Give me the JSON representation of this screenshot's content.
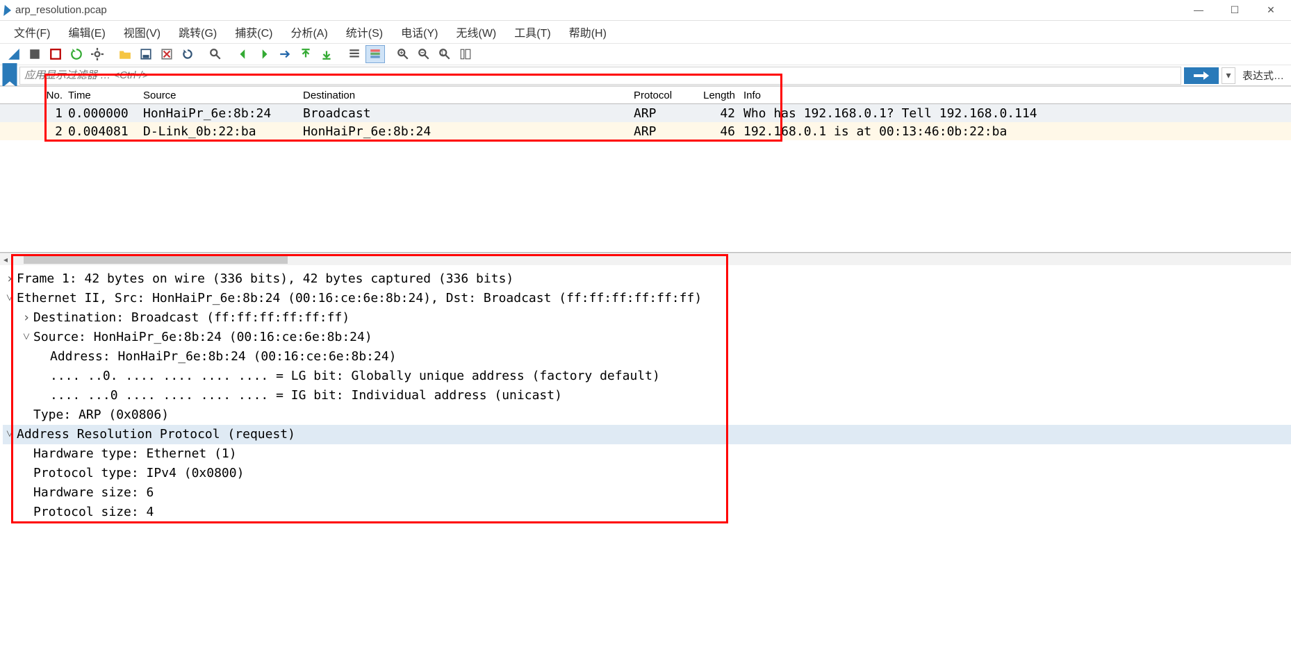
{
  "window": {
    "title": "arp_resolution.pcap"
  },
  "menu": [
    "文件(F)",
    "编辑(E)",
    "视图(V)",
    "跳转(G)",
    "捕获(C)",
    "分析(A)",
    "统计(S)",
    "电话(Y)",
    "无线(W)",
    "工具(T)",
    "帮助(H)"
  ],
  "toolbar_icons": [
    "fin",
    "start",
    "stop",
    "restart",
    "gear",
    "sep",
    "open",
    "save",
    "close",
    "reload",
    "sep",
    "find",
    "sep",
    "back",
    "fwd",
    "goto",
    "gotop",
    "gobot",
    "sep",
    "autoscroll",
    "coloring",
    "sep",
    "zoomin",
    "zoomout",
    "zoomreset",
    "resize"
  ],
  "filter": {
    "placeholder": "应用显示过滤器 … <Ctrl-/>",
    "expression_label": "表达式…"
  },
  "columns": {
    "no": "No.",
    "time": "Time",
    "source": "Source",
    "destination": "Destination",
    "protocol": "Protocol",
    "length": "Length",
    "info": "Info"
  },
  "packets": [
    {
      "no": "1",
      "time": "0.000000",
      "source": "HonHaiPr_6e:8b:24",
      "destination": "Broadcast",
      "protocol": "ARP",
      "length": "42",
      "info": "Who has 192.168.0.1? Tell 192.168.0.114",
      "sel": true
    },
    {
      "no": "2",
      "time": "0.004081",
      "source": "D-Link_0b:22:ba",
      "destination": "HonHaiPr_6e:8b:24",
      "protocol": "ARP",
      "length": "46",
      "info": "192.168.0.1 is at 00:13:46:0b:22:ba",
      "sel": false
    }
  ],
  "details": [
    {
      "tw": "›",
      "indent": 0,
      "text": "Frame 1: 42 bytes on wire (336 bits), 42 bytes captured (336 bits)",
      "hl": false
    },
    {
      "tw": "˅",
      "indent": 0,
      "text": "Ethernet II, Src: HonHaiPr_6e:8b:24 (00:16:ce:6e:8b:24), Dst: Broadcast (ff:ff:ff:ff:ff:ff)",
      "hl": false
    },
    {
      "tw": "›",
      "indent": 1,
      "text": "Destination: Broadcast (ff:ff:ff:ff:ff:ff)",
      "hl": false
    },
    {
      "tw": "˅",
      "indent": 1,
      "text": "Source: HonHaiPr_6e:8b:24 (00:16:ce:6e:8b:24)",
      "hl": false
    },
    {
      "tw": "",
      "indent": 2,
      "text": "Address: HonHaiPr_6e:8b:24 (00:16:ce:6e:8b:24)",
      "hl": false
    },
    {
      "tw": "",
      "indent": 2,
      "text": ".... ..0. .... .... .... .... = LG bit: Globally unique address (factory default)",
      "hl": false
    },
    {
      "tw": "",
      "indent": 2,
      "text": ".... ...0 .... .... .... .... = IG bit: Individual address (unicast)",
      "hl": false
    },
    {
      "tw": "",
      "indent": 1,
      "text": "Type: ARP (0x0806)",
      "hl": false
    },
    {
      "tw": "˅",
      "indent": 0,
      "text": "Address Resolution Protocol (request)",
      "hl": true
    },
    {
      "tw": "",
      "indent": 1,
      "text": "Hardware type: Ethernet (1)",
      "hl": false
    },
    {
      "tw": "",
      "indent": 1,
      "text": "Protocol type: IPv4 (0x0800)",
      "hl": false
    },
    {
      "tw": "",
      "indent": 1,
      "text": "Hardware size: 6",
      "hl": false
    },
    {
      "tw": "",
      "indent": 1,
      "text": "Protocol size: 4",
      "hl": false
    }
  ]
}
